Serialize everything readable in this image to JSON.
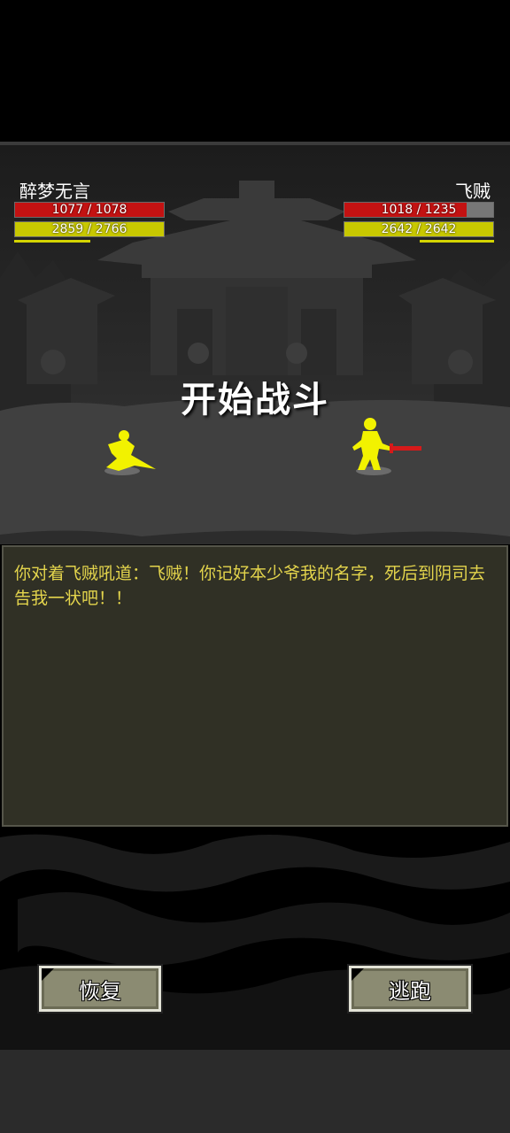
{
  "player": {
    "name": "醉梦无言",
    "hp_text": "1077 / 1078",
    "hp_current": 1077,
    "hp_max": 1078,
    "mp_text": "2859 / 2766",
    "mp_current": 2859,
    "mp_max": 2766
  },
  "enemy": {
    "name": "飞贼",
    "hp_text": "1018 / 1235",
    "hp_current": 1018,
    "hp_max": 1235,
    "mp_text": "2642 / 2642",
    "mp_current": 2642,
    "mp_max": 2642
  },
  "battle": {
    "title": "开始战斗"
  },
  "log": {
    "text": "你对着飞贼吼道：飞贼！你记好本少爷我的名字，死后到阴司去告我一状吧！！"
  },
  "actions": {
    "recover_label": "恢复",
    "escape_label": "逃跑"
  },
  "colors": {
    "hp": "#c31212",
    "mp": "#c8c800",
    "log_text": "#e3d44c",
    "fighter": "#f2f200"
  }
}
